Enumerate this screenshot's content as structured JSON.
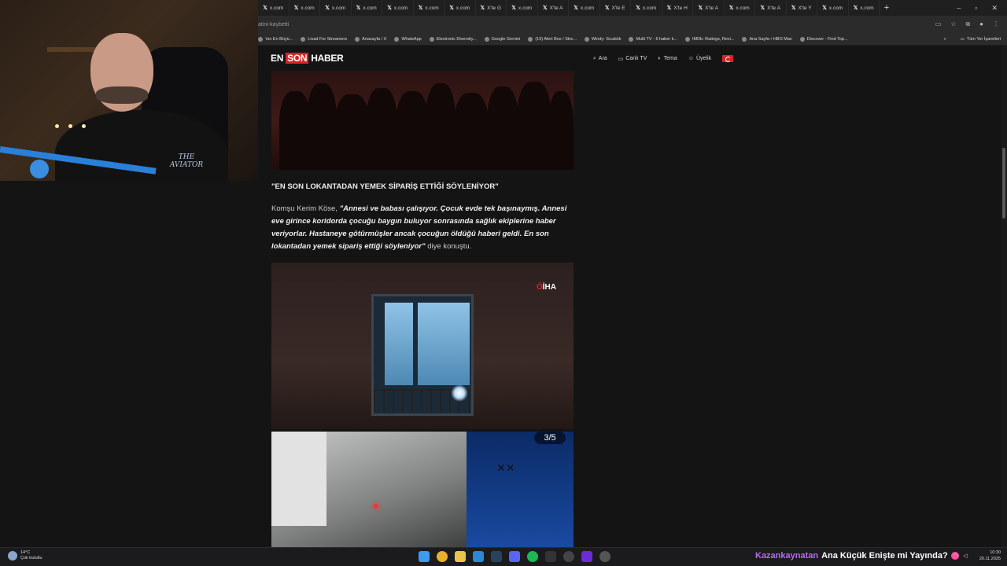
{
  "browser": {
    "tabs": [
      {
        "label": "x.com"
      },
      {
        "label": "x.com"
      },
      {
        "label": "x.com"
      },
      {
        "label": "x.com"
      },
      {
        "label": "x.com"
      },
      {
        "label": "x.com"
      },
      {
        "label": "x.com"
      },
      {
        "label": "X'te G"
      },
      {
        "label": "x.com"
      },
      {
        "label": "X'te A"
      },
      {
        "label": "x.com"
      },
      {
        "label": "X'te E"
      },
      {
        "label": "x.com"
      },
      {
        "label": "X'te H"
      },
      {
        "label": "X'te A"
      },
      {
        "label": "x.com"
      },
      {
        "label": "X'te A"
      },
      {
        "label": "X'te Y"
      },
      {
        "label": "x.com"
      },
      {
        "label": "x.com"
      }
    ],
    "new_tab": "+",
    "url_fragment": "atini-kaybetti",
    "bookmarks": [
      {
        "label": "'nin En Büyü..."
      },
      {
        "label": "Livad For Streamers"
      },
      {
        "label": "Anasayfa / X"
      },
      {
        "label": "WhatsApp"
      },
      {
        "label": "Electronic Diversity..."
      },
      {
        "label": "Google Gemini"
      },
      {
        "label": "(19) Alert Box / Stre..."
      },
      {
        "label": "Windy: Sıcaklık"
      },
      {
        "label": "Multi TV - 6 haber k..."
      },
      {
        "label": "IMDb: Ratings, Revi..."
      },
      {
        "label": "Ana Sayfa • HBO Max"
      },
      {
        "label": "Discover - Find Top..."
      }
    ],
    "bookmarks_overflow": "»",
    "all_bookmarks": "Tüm Yer İşaretleri"
  },
  "site": {
    "brand_en": "EN",
    "brand_son": "SON",
    "brand_haber": "HABER",
    "nav": [
      {
        "icon": "search-icon",
        "label": "Ara"
      },
      {
        "icon": "tv-icon",
        "label": "Canlı TV"
      },
      {
        "icon": "theme-icon",
        "label": "Tema"
      },
      {
        "icon": "user-icon",
        "label": "Üyelik"
      }
    ]
  },
  "article": {
    "subheading": "\"EN SON LOKANTADAN YEMEK SİPARİŞ ETTİĞİ SÖYLENİYOR\"",
    "paragraph_prefix": "Komşu Kerim Köse, ",
    "paragraph_quote": "\"Annesi ve babası çalışıyor. Çocuk evde tek başınaymış. Annesi eve girince koridorda çocuğu baygın buluyor sonrasında sağlık ekiplerine haber veriyorlar. Hastaneye götürmüşler ancak çocuğun öldüğü haberi geldi. En son lokantadan yemek sipariş ettiği söyleniyor\"",
    "paragraph_suffix": " diye konuştu.",
    "image2_watermark_c": "Ó",
    "image2_watermark": "İHA",
    "gallery_counter": "3/5"
  },
  "webcam": {
    "logo_text": "THE AVIATOR"
  },
  "taskbar": {
    "weather_temp": "14°C",
    "weather_desc": "Çok bulutlu",
    "ticker_channel": "Kazankaynatan",
    "ticker_message": "Ana Küçük Enişte mi Yayında?",
    "time": "10:30",
    "date": "20.11.2025"
  },
  "colors": {
    "brand_red": "#d6232a",
    "ticker_purple": "#b36cf0"
  }
}
